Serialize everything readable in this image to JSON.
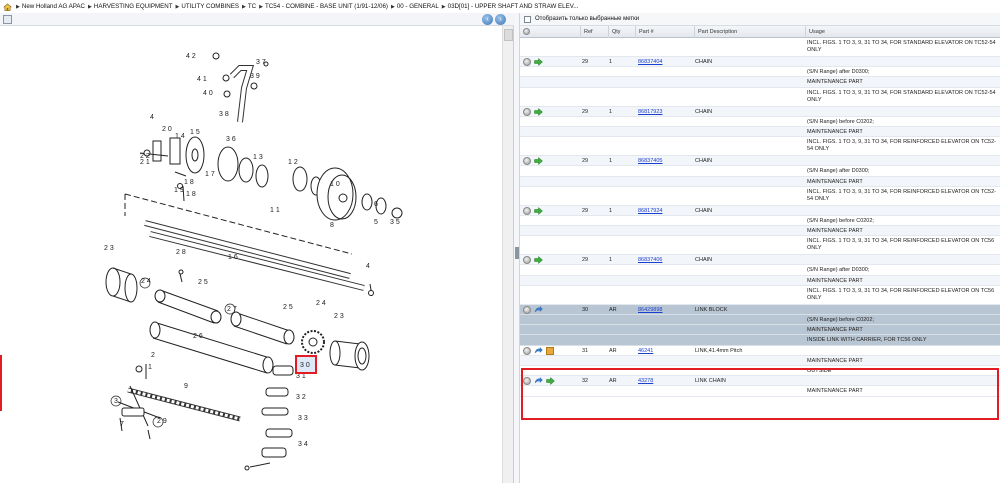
{
  "breadcrumb": [
    "New Holland AG APAC",
    "HARVESTING EQUIPMENT",
    "UTILITY COMBINES",
    "TC",
    "TC54 - COMBINE - BASE UNIT (1/91-12/06)",
    "00 - GENERAL",
    "03D[01] - UPPER SHAFT AND STRAW ELEV..."
  ],
  "filter": {
    "label": "Отобразить только выбранные метки"
  },
  "table": {
    "headers": [
      "Ref",
      "Qty",
      "Part #",
      "Part Description",
      "Usage"
    ],
    "rows": [
      {
        "usage": "INCL. FIGS. 1 TO 3, 9, 31 TO 34, FOR STANDARD ELEVATOR ON TC52-54 ONLY",
        "tall": true
      },
      {
        "ref": "29",
        "qty": "1",
        "part": "86837404",
        "desc": "CHAIN",
        "icons": [
          "info",
          "arrow-green"
        ],
        "alt": true
      },
      {
        "usage": "(S/N Range) after D0300;"
      },
      {
        "usage": "MAINTENANCE PART",
        "alt": true
      },
      {
        "usage": "INCL. FIGS. 1 TO 3, 9, 31 TO 34, FOR STANDARD ELEVATOR ON TC52-54 ONLY",
        "tall": true
      },
      {
        "ref": "29",
        "qty": "1",
        "part": "86817923",
        "desc": "CHAIN",
        "icons": [
          "info",
          "arrow-green"
        ],
        "alt": true
      },
      {
        "usage": "(S/N Range) before C0202;"
      },
      {
        "usage": "MAINTENANCE PART",
        "alt": true
      },
      {
        "usage": "INCL. FIGS. 1 TO 3, 9, 31 TO 34, FOR REINFORCED ELEVATOR ON TC52-54 ONLY",
        "tall": true
      },
      {
        "ref": "29",
        "qty": "1",
        "part": "86837405",
        "desc": "CHAIN",
        "icons": [
          "info",
          "arrow-green"
        ],
        "alt": true
      },
      {
        "usage": "(S/N Range) after D0300;"
      },
      {
        "usage": "MAINTENANCE PART",
        "alt": true
      },
      {
        "usage": "INCL. FIGS. 1 TO 3, 9, 31 TO 34, FOR REINFORCED ELEVATOR ON TC52-54 ONLY",
        "tall": true
      },
      {
        "ref": "29",
        "qty": "1",
        "part": "86817924",
        "desc": "CHAIN",
        "icons": [
          "info",
          "arrow-green"
        ],
        "alt": true
      },
      {
        "usage": "(S/N Range) before C0202;"
      },
      {
        "usage": "MAINTENANCE PART",
        "alt": true
      },
      {
        "usage": "INCL. FIGS. 1 TO 3, 9, 31 TO 34, FOR REINFORCED ELEVATOR ON TC56 ONLY",
        "tall": true
      },
      {
        "ref": "29",
        "qty": "1",
        "part": "86837406",
        "desc": "CHAIN",
        "icons": [
          "info",
          "arrow-green"
        ],
        "alt": true
      },
      {
        "usage": "(S/N Range) after D0300;"
      },
      {
        "usage": "MAINTENANCE PART",
        "alt": true
      },
      {
        "usage": "INCL. FIGS. 1 TO 3, 9, 31 TO 34, FOR REINFORCED ELEVATOR ON TC56 ONLY",
        "tall": true
      },
      {
        "ref": "30",
        "qty": "AR",
        "part": "86429898",
        "desc": "LINK BLOCK",
        "icons": [
          "info",
          "arrow-blue"
        ],
        "sel": true
      },
      {
        "usage": "(S/N Range) before C0202;",
        "sel": true
      },
      {
        "usage": "MAINTENANCE PART",
        "sel": true
      },
      {
        "usage": "INSIDE LINK WITH CARRIER, FOR TC56 ONLY",
        "sel": true
      },
      {
        "ref": "31",
        "qty": "AR",
        "part": "46241",
        "desc": "LINK,41.4mm Pitch",
        "icons": [
          "info",
          "arrow-blue",
          "box"
        ]
      },
      {
        "usage": "MAINTENANCE PART",
        "alt": true
      },
      {
        "usage": "OUTSIDE"
      },
      {
        "ref": "32",
        "qty": "AR",
        "part": "43278",
        "desc": "LINK CHAIN",
        "icons": [
          "info",
          "arrow-blue",
          "arrow-green"
        ],
        "alt": true
      },
      {
        "usage": "MAINTENANCE PART"
      }
    ]
  },
  "diagram": {
    "callouts": [
      "42",
      "37",
      "39",
      "41",
      "40",
      "38",
      "4",
      "20",
      "14",
      "15",
      "36",
      "13",
      "22",
      "21",
      "12",
      "10",
      "18",
      "17",
      "19",
      "8",
      "11",
      "5",
      "3",
      "35",
      "6",
      "16",
      "23",
      "28",
      "4",
      "24",
      "25",
      "27",
      "25",
      "24",
      "23",
      "26",
      "30",
      "31",
      "32",
      "33",
      "34",
      "1",
      "2",
      "3",
      "9",
      "29",
      "7"
    ],
    "highlighted_callout": "30"
  },
  "colors": {
    "highlight": "#e31c23",
    "selected_row": "#b8c5d2",
    "link": "#1a3fd1"
  }
}
